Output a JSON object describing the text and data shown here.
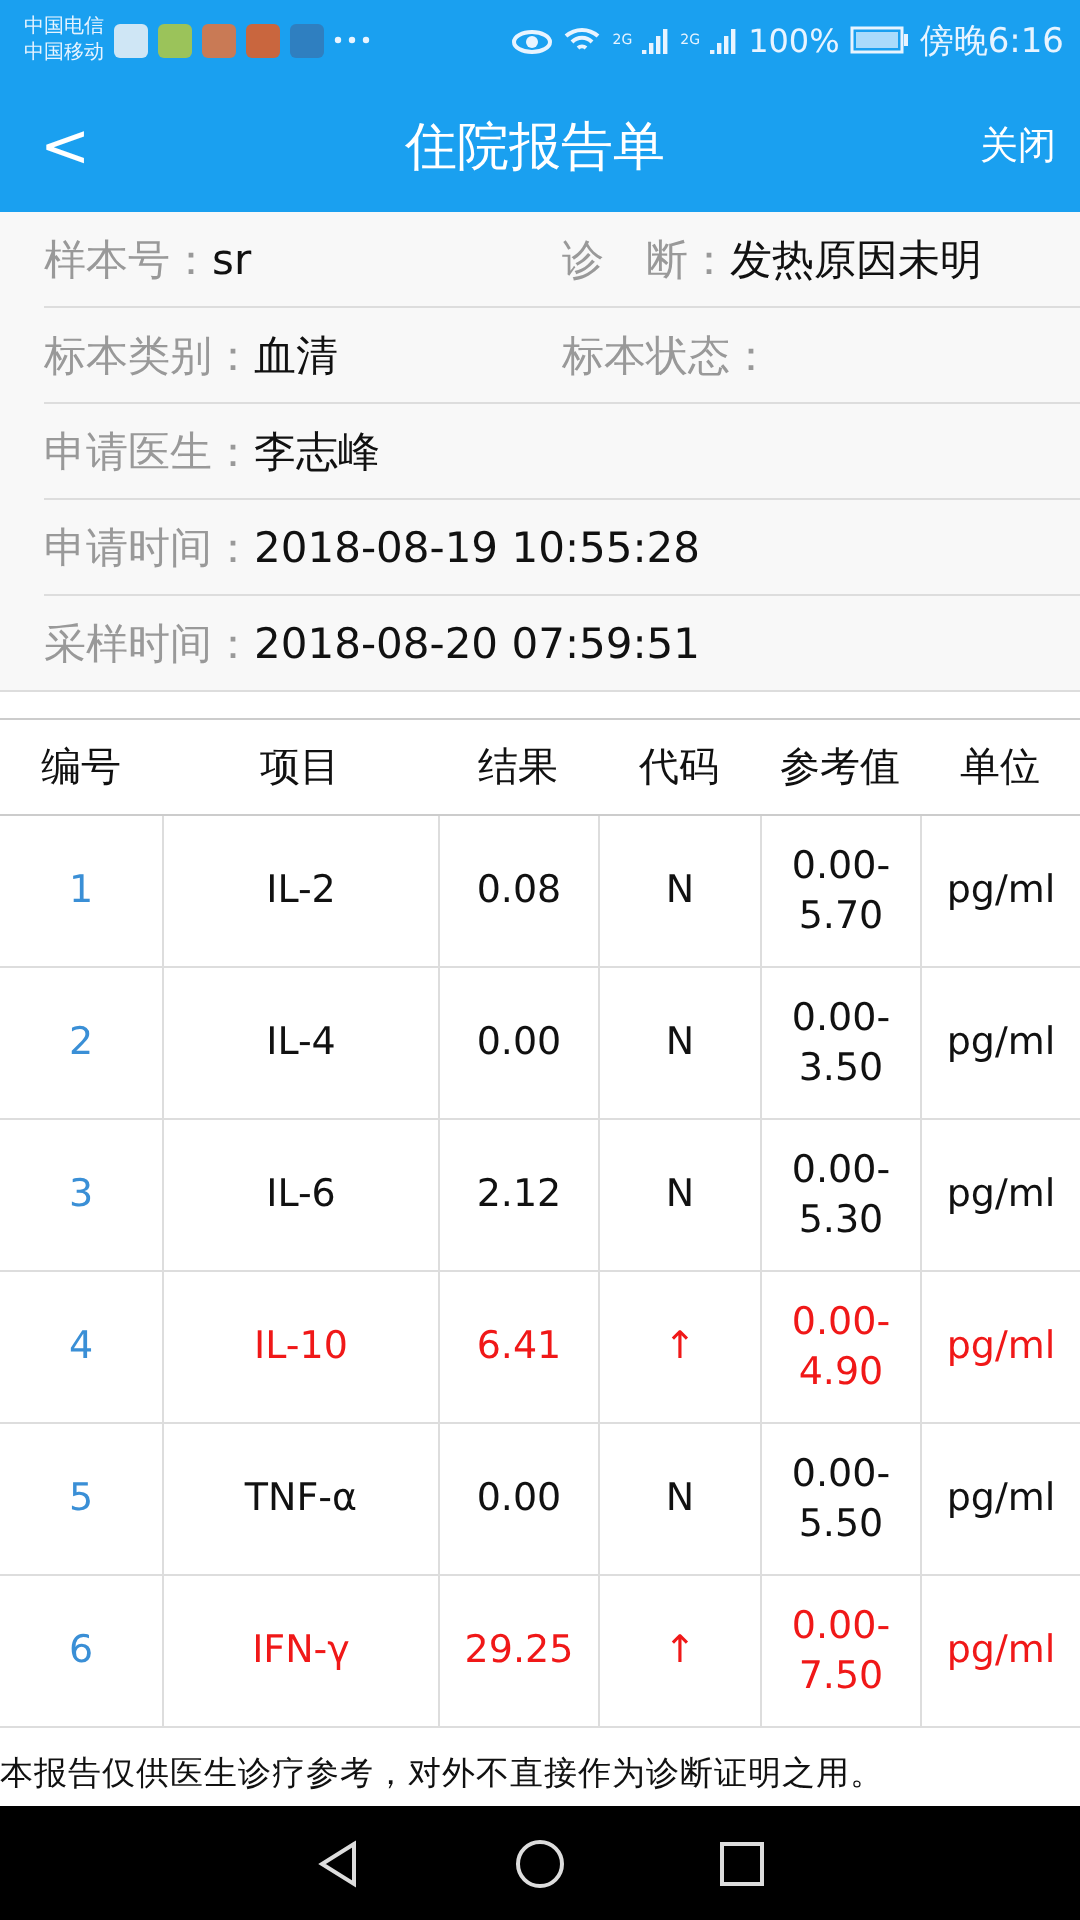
{
  "status_bar": {
    "carriers": [
      "中国电信",
      "中国移动"
    ],
    "network_labels": [
      "2G",
      "2G"
    ],
    "battery": "100%",
    "time": "傍晚6:16"
  },
  "header": {
    "back": "<",
    "title": "住院报告单",
    "close": "关闭"
  },
  "info_rows": [
    {
      "fields": [
        {
          "label": "样本号：",
          "value": "sr"
        },
        {
          "label": "诊　断：",
          "value": "发热原因未明"
        }
      ]
    },
    {
      "fields": [
        {
          "label": "标本类别：",
          "value": "血清"
        },
        {
          "label": "标本状态："
        }
      ]
    },
    {
      "fields": [
        {
          "label": "申请医生：",
          "value": "李志峰"
        }
      ]
    },
    {
      "fields": [
        {
          "label": "申请时间：",
          "value": "2018-08-19 10:55:28"
        }
      ]
    },
    {
      "fields": [
        {
          "label": "采样时间：",
          "value": "2018-08-20 07:59:51"
        }
      ]
    }
  ],
  "table": {
    "columns": [
      "编号",
      "项目",
      "结果",
      "代码",
      "参考值",
      "单位"
    ],
    "rows": [
      {
        "no": "1",
        "item": "IL-2",
        "result": "0.08",
        "code": "N",
        "ref": [
          "0.00-",
          "5.70"
        ],
        "unit": "pg/ml",
        "abnormal": false
      },
      {
        "no": "2",
        "item": "IL-4",
        "result": "0.00",
        "code": "N",
        "ref": [
          "0.00-",
          "3.50"
        ],
        "unit": "pg/ml",
        "abnormal": false
      },
      {
        "no": "3",
        "item": "IL-6",
        "result": "2.12",
        "code": "N",
        "ref": [
          "0.00-",
          "5.30"
        ],
        "unit": "pg/ml",
        "abnormal": false
      },
      {
        "no": "4",
        "item": "IL-10",
        "result": "6.41",
        "code": "↑",
        "ref": [
          "0.00-",
          "4.90"
        ],
        "unit": "pg/ml",
        "abnormal": true
      },
      {
        "no": "5",
        "item": "TNF-α",
        "result": "0.00",
        "code": "N",
        "ref": [
          "0.00-",
          "5.50"
        ],
        "unit": "pg/ml",
        "abnormal": false
      },
      {
        "no": "6",
        "item": "IFN-γ",
        "result": "29.25",
        "code": "↑",
        "ref": [
          "0.00-",
          "7.50"
        ],
        "unit": "pg/ml",
        "abnormal": true
      }
    ]
  },
  "footer_note": "本报告仅供医生诊疗参考，对外不直接作为诊断证明之用。"
}
